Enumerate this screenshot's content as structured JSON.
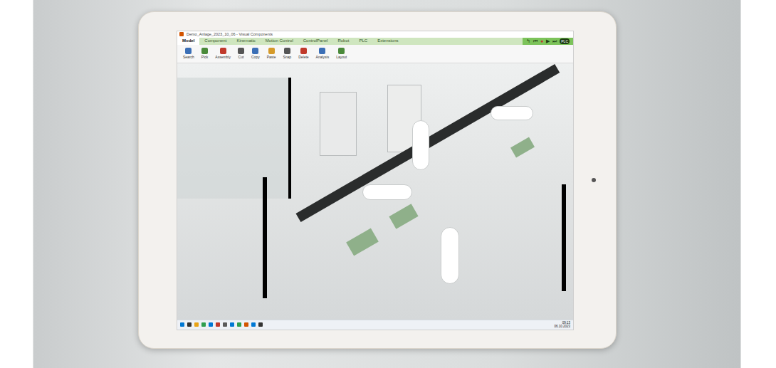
{
  "window": {
    "title": "Demo_Anlage_2023_10_06 - Visual Components"
  },
  "ribbon_tabs": [
    {
      "label": "Model",
      "selected": true
    },
    {
      "label": "Component",
      "selected": false
    },
    {
      "label": "Kinematic",
      "selected": false
    },
    {
      "label": "Motion Control",
      "selected": false
    },
    {
      "label": "ControlPanel",
      "selected": false
    },
    {
      "label": "Robot",
      "selected": false
    },
    {
      "label": "PLC",
      "selected": false
    },
    {
      "label": "Extensions",
      "selected": false
    }
  ],
  "playback": [
    "↰",
    "⏮",
    "●",
    "▶",
    "⏭"
  ],
  "plc_badge": "PLC",
  "toolbar": [
    {
      "label": "Search",
      "color": "#3b6fb6"
    },
    {
      "label": "Pick",
      "color": "#4a8a3a"
    },
    {
      "label": "Assembly",
      "color": "#c0392b"
    },
    {
      "label": "Cut",
      "color": "#555555"
    },
    {
      "label": "Copy",
      "color": "#3b6fb6"
    },
    {
      "label": "Paste",
      "color": "#d59a2a"
    },
    {
      "label": "Snap",
      "color": "#555555"
    },
    {
      "label": "Delete",
      "color": "#c0392b"
    },
    {
      "label": "Analysis",
      "color": "#3b6fb6"
    },
    {
      "label": "Layout",
      "color": "#4a8a3a"
    }
  ],
  "taskbar": {
    "time": "09:13",
    "date": "06.10.2023"
  }
}
